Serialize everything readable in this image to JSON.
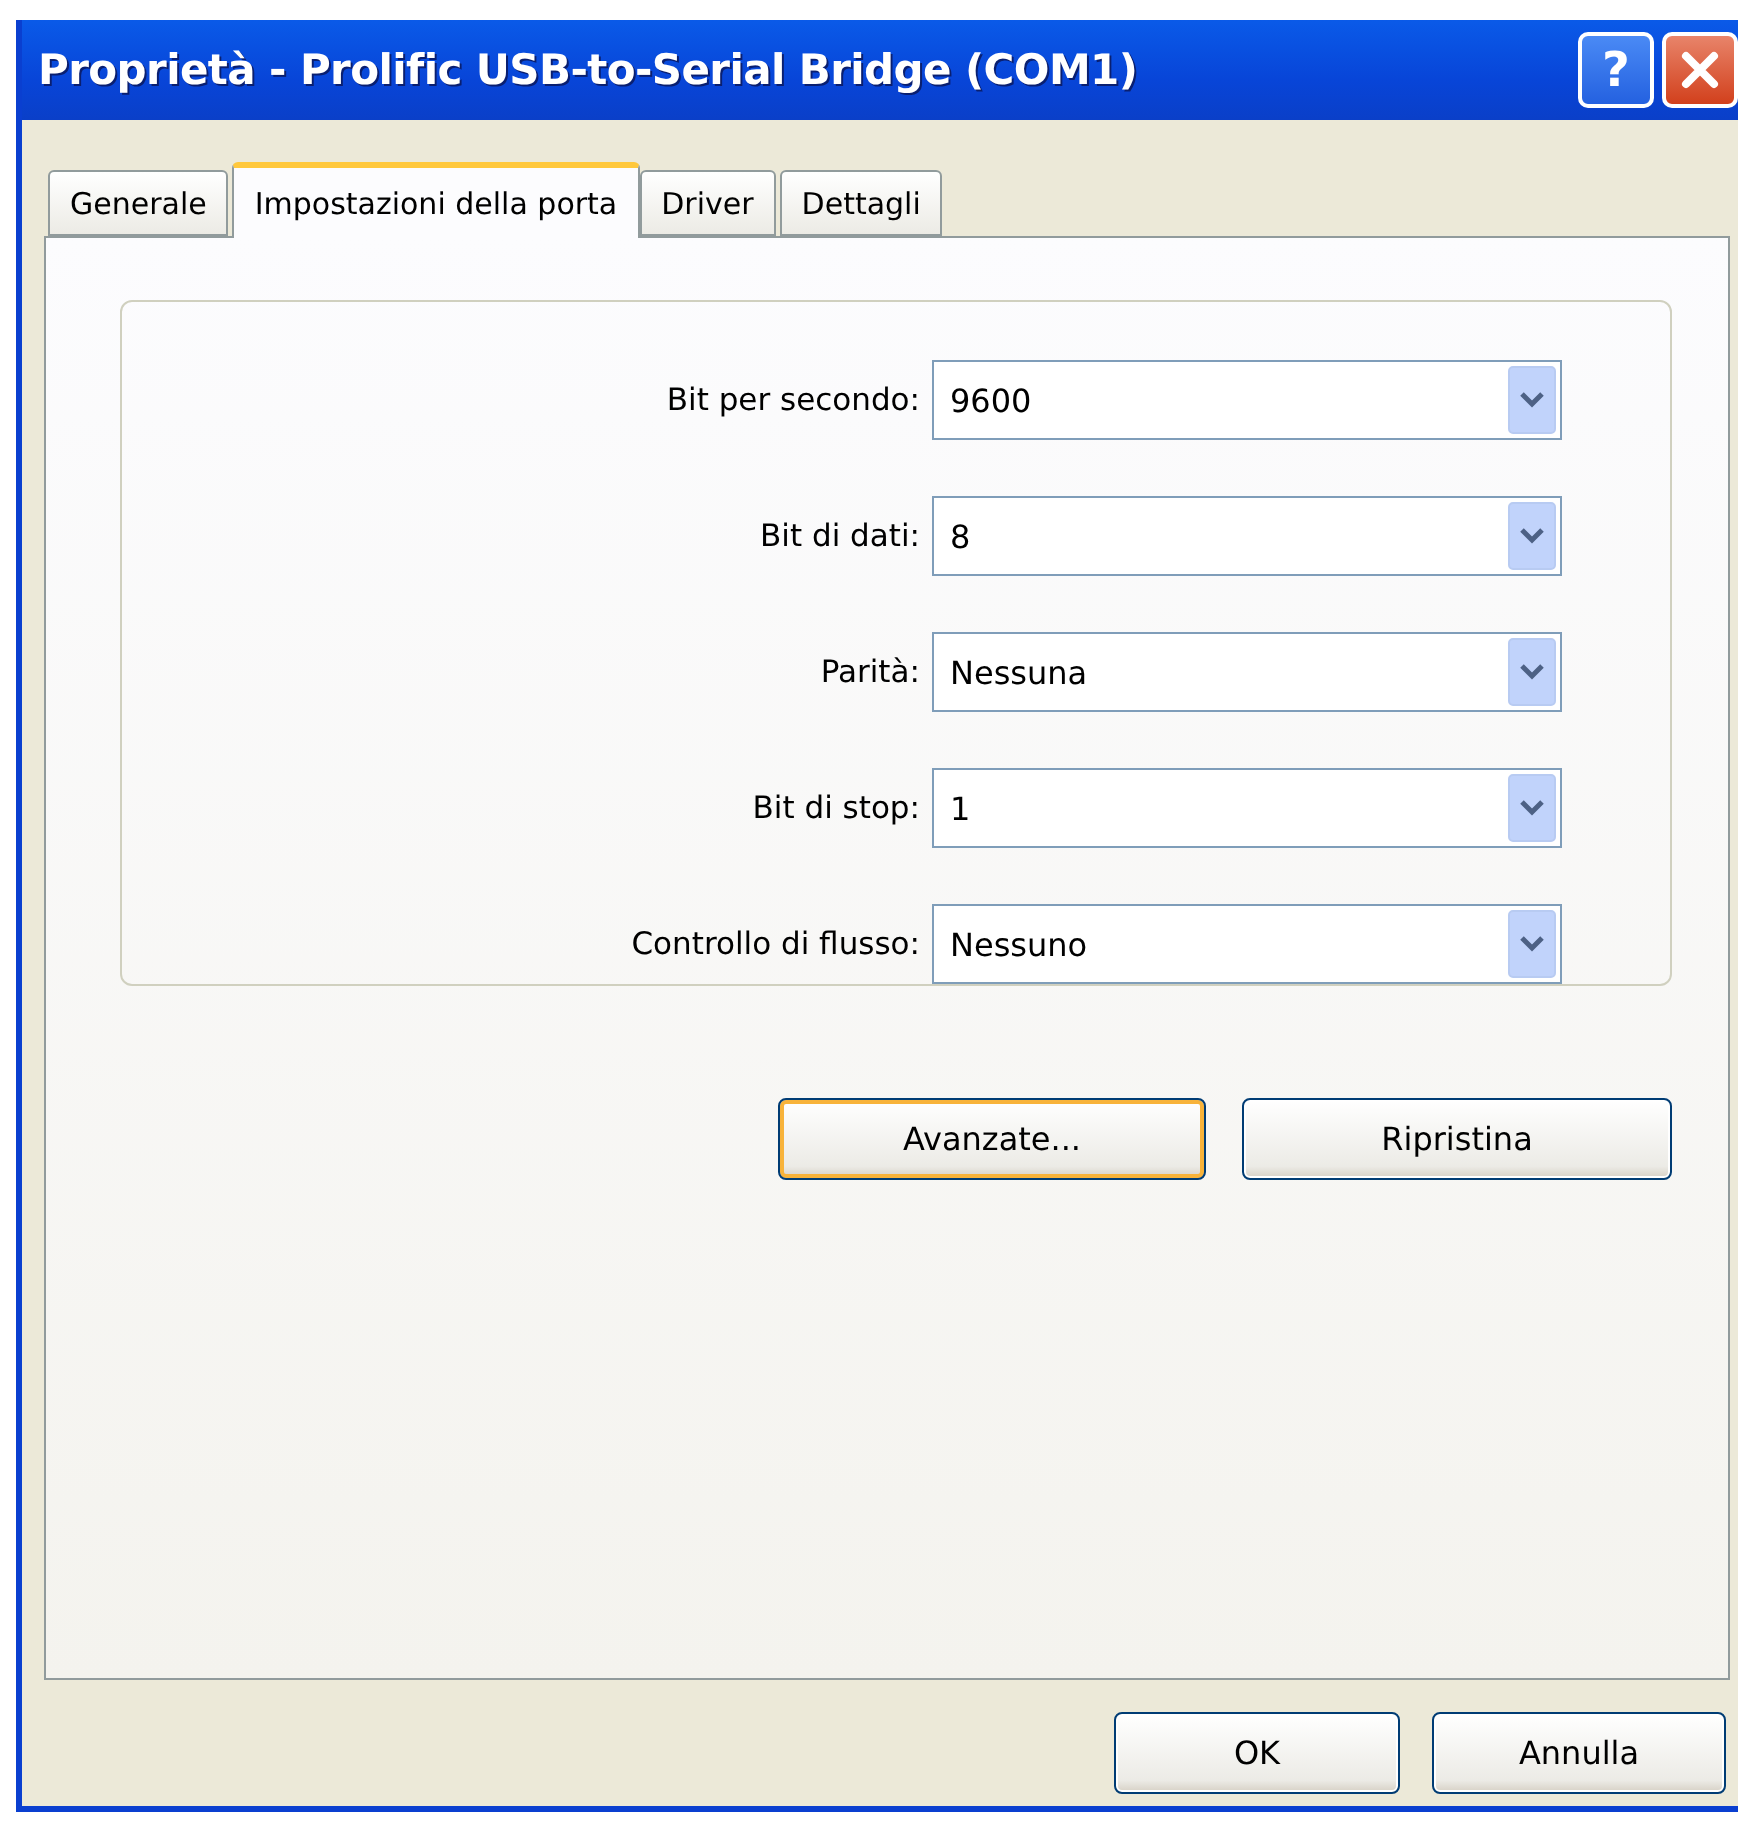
{
  "window": {
    "title": "Proprietà - Prolific USB-to-Serial Bridge (COM1)",
    "help_button": "?"
  },
  "tabs": [
    {
      "label": "Generale",
      "selected": false
    },
    {
      "label": "Impostazioni della porta",
      "selected": true
    },
    {
      "label": "Driver",
      "selected": false
    },
    {
      "label": "Dettagli",
      "selected": false
    }
  ],
  "settings": [
    {
      "label": "Bit per secondo:",
      "value": "9600"
    },
    {
      "label": "Bit di dati:",
      "value": "8"
    },
    {
      "label": "Parità:",
      "value": "Nessuna"
    },
    {
      "label": "Bit di stop:",
      "value": "1"
    },
    {
      "label": "Controllo di flusso:",
      "value": "Nessuno"
    }
  ],
  "panel_buttons": [
    {
      "label": "Avanzate...",
      "focused": true
    },
    {
      "label": "Ripristina",
      "focused": false
    }
  ],
  "buttons": [
    {
      "label": "OK",
      "focused": false
    },
    {
      "label": "Annulla",
      "focused": false
    }
  ]
}
